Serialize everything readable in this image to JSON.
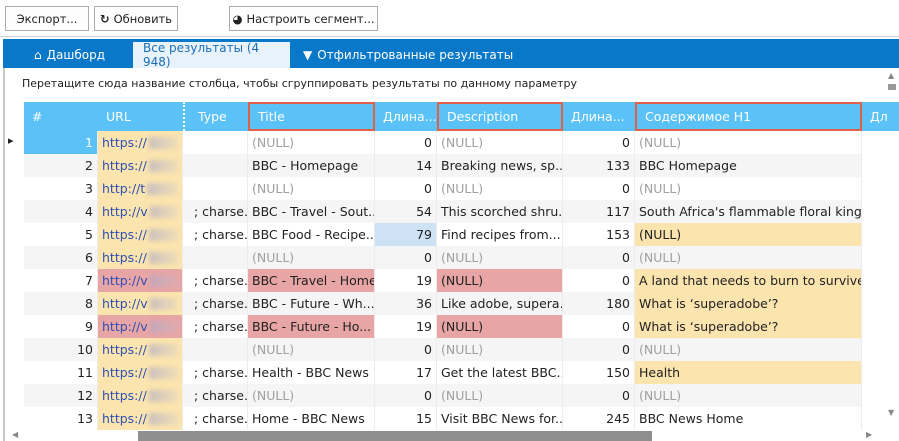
{
  "toolbar": {
    "export_label": "Экспорт...",
    "refresh_label": "Обновить",
    "segment_label": "Настроить сегмент..."
  },
  "tabs": [
    {
      "label": "Дашборд",
      "icon": "home-icon"
    },
    {
      "label": "Все результаты (4 948)",
      "active": true
    },
    {
      "label": "Отфильтрованные результаты",
      "icon": "filter-icon"
    }
  ],
  "group_hint": "Перетащите сюда название столбца, чтобы сгруппировать результаты по данному параметру",
  "colors": {
    "header": "#5bc2f7",
    "tabbar": "#0a78c8",
    "highlight_yellow": "#fbe4ae",
    "highlight_red": "#e8a5a5",
    "selected": "#cde3f5",
    "outline": "#e0614a"
  },
  "columns": [
    "#",
    "URL",
    "Type",
    "Title",
    "Длина...",
    "Description",
    "Длина...",
    "Содержимое H1",
    "Дл"
  ],
  "rows": [
    {
      "n": "1",
      "url": "https://",
      "type": "",
      "title": "(NULL)",
      "tlen": "0",
      "desc": "(NULL)",
      "dlen": "0",
      "h1": "(NULL)",
      "hl": {}
    },
    {
      "n": "2",
      "url": "https://",
      "type": "",
      "title": "BBC - Homepage",
      "tlen": "14",
      "desc": "Breaking news, sp...",
      "dlen": "133",
      "h1": "BBC Homepage",
      "hl": {}
    },
    {
      "n": "3",
      "url": "http://t",
      "type": "",
      "title": "(NULL)",
      "tlen": "0",
      "desc": "(NULL)",
      "dlen": "0",
      "h1": "(NULL)",
      "hl": {}
    },
    {
      "n": "4",
      "url": "http://v",
      "type": "; charse...",
      "title": "BBC - Travel - Sout...",
      "tlen": "54",
      "desc": "This scorched shru...",
      "dlen": "117",
      "h1": "South Africa's flammable floral king...",
      "hl": {}
    },
    {
      "n": "5",
      "url": "https://",
      "type": "; charse...",
      "title": "BBC Food - Recipe...",
      "tlen": "79",
      "desc": "Find recipes from...",
      "dlen": "153",
      "h1": "(NULL)",
      "hl": {
        "h1": "yellow",
        "tlen": "selected"
      }
    },
    {
      "n": "6",
      "url": "https://",
      "type": "",
      "title": "(NULL)",
      "tlen": "0",
      "desc": "(NULL)",
      "dlen": "0",
      "h1": "(NULL)",
      "hl": {}
    },
    {
      "n": "7",
      "url": "http://v",
      "type": "; charse...",
      "title": "BBC - Travel - Home",
      "tlen": "19",
      "desc": "(NULL)",
      "dlen": "0",
      "h1": "A land that needs to burn to survive",
      "hl": {
        "url": "red",
        "title": "red",
        "desc": "red",
        "h1": "yellow"
      }
    },
    {
      "n": "8",
      "url": "http://v",
      "type": "; charse...",
      "title": "BBC - Future - Wh...",
      "tlen": "36",
      "desc": "Like adobe, supera...",
      "dlen": "180",
      "h1": "What is ‘superadobe’?",
      "hl": {
        "h1": "yellow"
      }
    },
    {
      "n": "9",
      "url": "http://v",
      "type": "; charse...",
      "title": "BBC - Future - Ho...",
      "tlen": "19",
      "desc": "(NULL)",
      "dlen": "0",
      "h1": "What is ‘superadobe’?",
      "hl": {
        "url": "red",
        "title": "red",
        "desc": "red",
        "h1": "yellow"
      }
    },
    {
      "n": "10",
      "url": "https://",
      "type": "",
      "title": "(NULL)",
      "tlen": "0",
      "desc": "(NULL)",
      "dlen": "0",
      "h1": "(NULL)",
      "hl": {}
    },
    {
      "n": "11",
      "url": "https://",
      "type": "; charse...",
      "title": "Health - BBC News",
      "tlen": "17",
      "desc": "Get the latest BBC...",
      "dlen": "150",
      "h1": "Health",
      "hl": {
        "h1": "yellow"
      }
    },
    {
      "n": "12",
      "url": "https://",
      "type": "; charse...",
      "title": "(NULL)",
      "tlen": "0",
      "desc": "(NULL)",
      "dlen": "0",
      "h1": "(NULL)",
      "hl": {}
    },
    {
      "n": "13",
      "url": "https://",
      "type": "; charse...",
      "title": "Home - BBC News",
      "tlen": "15",
      "desc": "Visit BBC News for...",
      "dlen": "245",
      "h1": "BBC News Home",
      "hl": {}
    }
  ]
}
